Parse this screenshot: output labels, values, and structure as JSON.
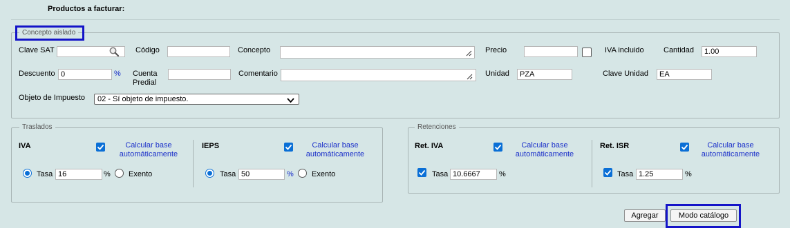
{
  "section_title": "Productos a facturar:",
  "concepto": {
    "legend": "Concepto aislado",
    "clave_sat_label": "Clave SAT",
    "clave_sat_value": "",
    "codigo_label": "Código",
    "codigo_value": "",
    "concepto_label": "Concepto",
    "concepto_value": "",
    "precio_label": "Precio",
    "precio_value": "",
    "iva_incluido_label": "IVA incluido",
    "cantidad_label": "Cantidad",
    "cantidad_value": "1.00",
    "descuento_label": "Descuento",
    "descuento_value": "0",
    "descuento_unit": "%",
    "cuenta_predial_label_1": "Cuenta",
    "cuenta_predial_label_2": "Predial",
    "cuenta_predial_value": "",
    "comentario_label": "Comentario",
    "comentario_value": "",
    "unidad_label": "Unidad",
    "unidad_value": "PZA",
    "clave_unidad_label": "Clave Unidad",
    "clave_unidad_value": "EA",
    "objeto_impuesto_label": "Objeto de Impuesto",
    "objeto_impuesto_value": "02 - Sí objeto de impuesto."
  },
  "traslados": {
    "legend": "Traslados",
    "iva": {
      "title": "IVA",
      "calc_label_1": "Calcular base",
      "calc_label_2": "automáticamente",
      "tasa_label": "Tasa",
      "tasa_value": "16",
      "unit": "%",
      "exento_label": "Exento"
    },
    "ieps": {
      "title": "IEPS",
      "calc_label_1": "Calcular base",
      "calc_label_2": "automáticamente",
      "tasa_label": "Tasa",
      "tasa_value": "50",
      "unit": "%",
      "exento_label": "Exento"
    }
  },
  "retenciones": {
    "legend": "Retenciones",
    "ret_iva": {
      "title": "Ret. IVA",
      "calc_label_1": "Calcular base",
      "calc_label_2": "automáticamente",
      "tasa_label": "Tasa",
      "tasa_value": "10.6667",
      "unit": "%"
    },
    "ret_isr": {
      "title": "Ret. ISR",
      "calc_label_1": "Calcular base",
      "calc_label_2": "automáticamente",
      "tasa_label": "Tasa",
      "tasa_value": "1.25",
      "unit": "%"
    }
  },
  "buttons": {
    "agregar": "Agregar",
    "modo_catalogo": "Modo catálogo"
  },
  "colors": {
    "background": "#d6e6e6",
    "link_blue": "#1a2fc9",
    "check_blue": "#0a6fd6",
    "highlight": "#1414c8"
  }
}
